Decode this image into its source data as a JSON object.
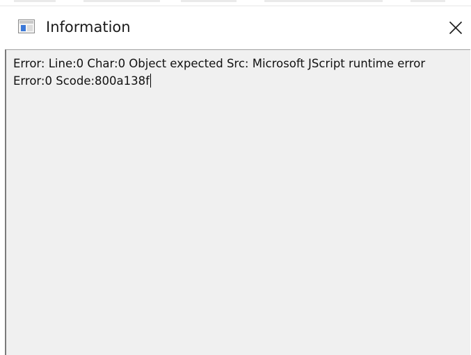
{
  "window": {
    "title": "Information",
    "icon": "window-app-icon",
    "close_icon": "close-icon"
  },
  "content": {
    "message": "Error: Line:0 Char:0 Object expected Src: Microsoft JScript runtime error Error:0 Scode:800a138f"
  },
  "colors": {
    "title_bar": "#ffffff",
    "content_bg": "#f0f0f0",
    "text": "#111111",
    "icon_accent": "#3b78d8"
  }
}
